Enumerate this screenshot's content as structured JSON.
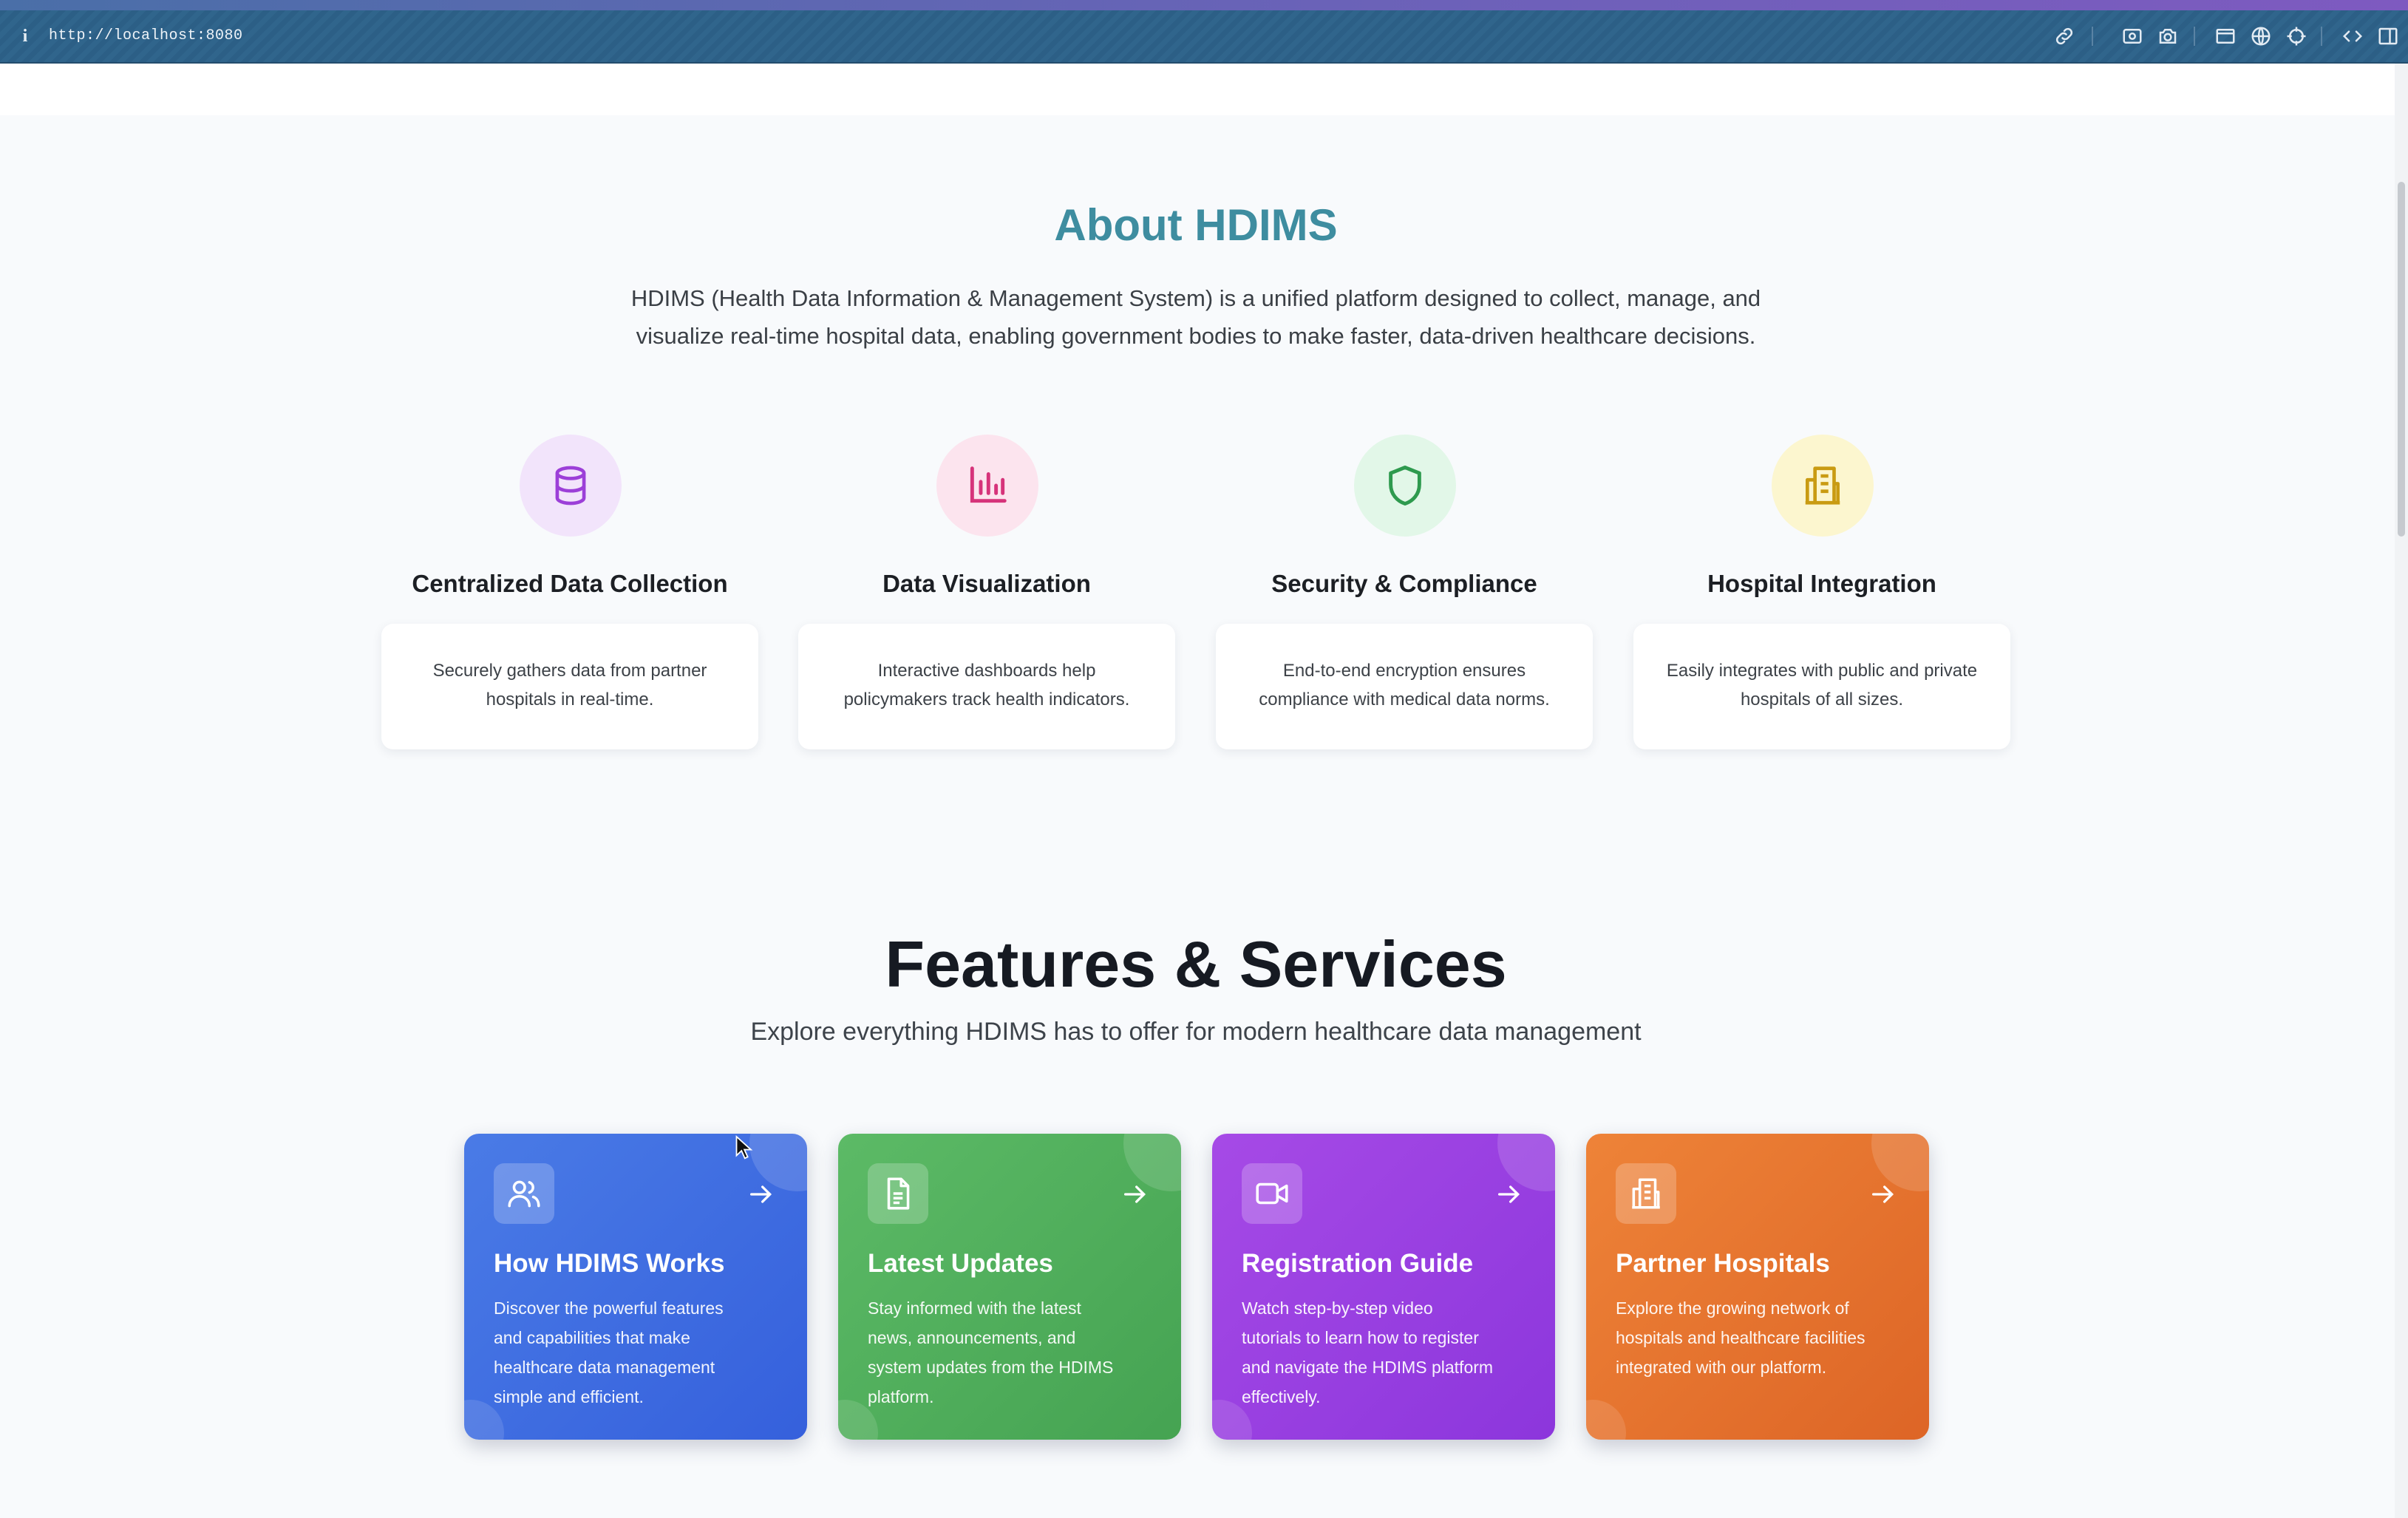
{
  "browser": {
    "url": "http://localhost:8080",
    "info_glyph": "i",
    "toolbar_icons": [
      "link-icon",
      "screenshot-icon",
      "camera-icon",
      "window-icon",
      "globe-icon",
      "crosshair-icon",
      "code-icon",
      "sidebar-icon"
    ]
  },
  "about": {
    "title": "About HDIMS",
    "description_line1": "HDIMS (Health Data Information & Management System) is a unified platform designed to collect, manage, and",
    "description_line2": "visualize real-time hospital data, enabling government bodies to make faster, data-driven healthcare decisions.",
    "features": [
      {
        "icon": "database-icon",
        "title": "Centralized Data Collection",
        "desc_line1": "Securely gathers data from partner",
        "desc_line2": "hospitals in real-time.",
        "circle_color": "#f2e4fb",
        "icon_color": "#9c3fd8"
      },
      {
        "icon": "bar-chart-icon",
        "title": "Data Visualization",
        "desc_line1": "Interactive dashboards help",
        "desc_line2": "policymakers track health indicators.",
        "circle_color": "#fce4ee",
        "icon_color": "#d6337a"
      },
      {
        "icon": "shield-icon",
        "title": "Security & Compliance",
        "desc_line1": "End-to-end encryption ensures",
        "desc_line2": "compliance with medical data norms.",
        "circle_color": "#e2f7e8",
        "icon_color": "#2e9a4e"
      },
      {
        "icon": "building-icon",
        "title": "Hospital Integration",
        "desc_line1": "Easily integrates with public and private",
        "desc_line2": "hospitals of all sizes.",
        "circle_color": "#fcf6cf",
        "icon_color": "#c99b12"
      }
    ]
  },
  "services": {
    "title": "Features & Services",
    "subtitle": "Explore everything HDIMS has to offer for modern healthcare data management",
    "cards": [
      {
        "icon": "users-icon",
        "title": "How HDIMS Works",
        "desc_lines": [
          "Discover the powerful features",
          "and capabilities that make",
          "healthcare data management",
          "simple and efficient."
        ],
        "gradient_from": "#4a7be6",
        "gradient_to": "#3560dc"
      },
      {
        "icon": "document-icon",
        "title": "Latest Updates",
        "desc_lines": [
          "Stay informed with the latest",
          "news, announcements, and",
          "system updates from the HDIMS",
          "platform."
        ],
        "gradient_from": "#5cba66",
        "gradient_to": "#45a352"
      },
      {
        "icon": "video-icon",
        "title": "Registration Guide",
        "desc_lines": [
          "Watch step-by-step video",
          "tutorials to learn how to register",
          "and navigate the HDIMS platform",
          "effectively."
        ],
        "gradient_from": "#a64ae6",
        "gradient_to": "#8c36dc"
      },
      {
        "icon": "building-icon",
        "title": "Partner Hospitals",
        "desc_lines": [
          "Explore the growing network of",
          "hospitals and healthcare facilities",
          "integrated with our platform."
        ],
        "gradient_from": "#ee8338",
        "gradient_to": "#dd6526"
      }
    ],
    "arrow_icon": "arrow-right-icon"
  }
}
